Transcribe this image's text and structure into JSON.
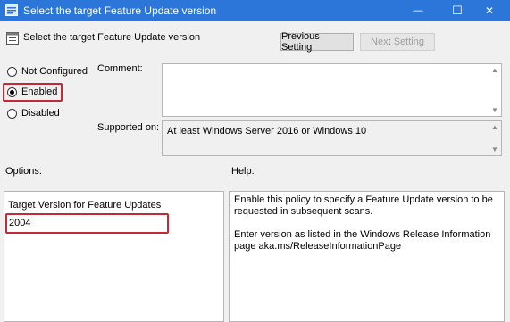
{
  "window": {
    "title": "Select the target Feature Update version",
    "minimize_glyph": "—",
    "maximize_glyph": "☐",
    "close_glyph": "✕"
  },
  "header": {
    "policy_title": "Select the target Feature Update version",
    "previous_setting": "Previous Setting",
    "next_setting": "Next Setting"
  },
  "state": {
    "not_configured": "Not Configured",
    "enabled": "Enabled",
    "disabled": "Disabled",
    "selected": "Enabled"
  },
  "comment": {
    "label": "Comment:",
    "value": ""
  },
  "supported": {
    "label": "Supported on:",
    "value": "At least Windows Server 2016 or Windows 10"
  },
  "options": {
    "label": "Options:",
    "field_label": "Target Version for Feature Updates",
    "field_value": "2004"
  },
  "help": {
    "label": "Help:",
    "para1": "Enable this policy to specify a Feature Update version to be requested in subsequent scans.",
    "para2": "Enter version as listed in the Windows Release Information page aka.ms/ReleaseInformationPage"
  },
  "colors": {
    "titlebar": "#2b76d8",
    "highlight": "#c22a3a"
  }
}
